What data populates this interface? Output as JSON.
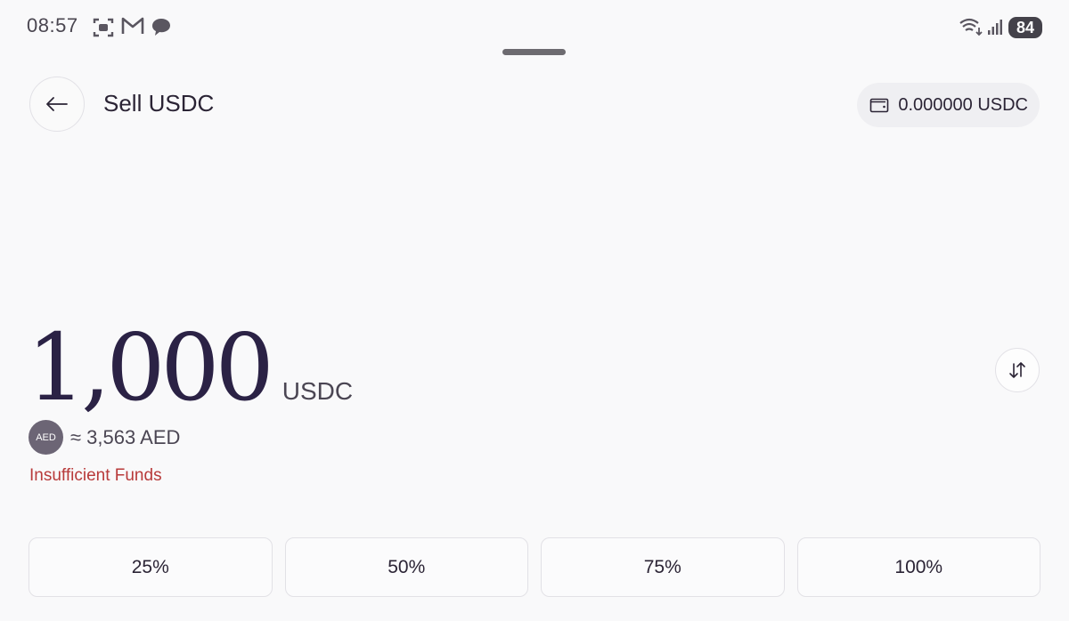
{
  "status_bar": {
    "time": "08:57",
    "notification_icons": [
      "screenshot-icon",
      "gmail-icon",
      "chat-icon"
    ],
    "battery_level": "84"
  },
  "header": {
    "title": "Sell USDC",
    "balance": "0.000000 USDC"
  },
  "amount": {
    "value": "1,000",
    "unit": "USDC",
    "fiat_badge": "AED",
    "fiat_equivalent": "≈ 3,563 AED",
    "error": "Insufficient Funds"
  },
  "percent_buttons": [
    "25%",
    "50%",
    "75%",
    "100%"
  ],
  "colors": {
    "background": "#f9f9fa",
    "amount_text": "#2b2245",
    "error": "#b83a3a",
    "badge": "#6c6575"
  }
}
